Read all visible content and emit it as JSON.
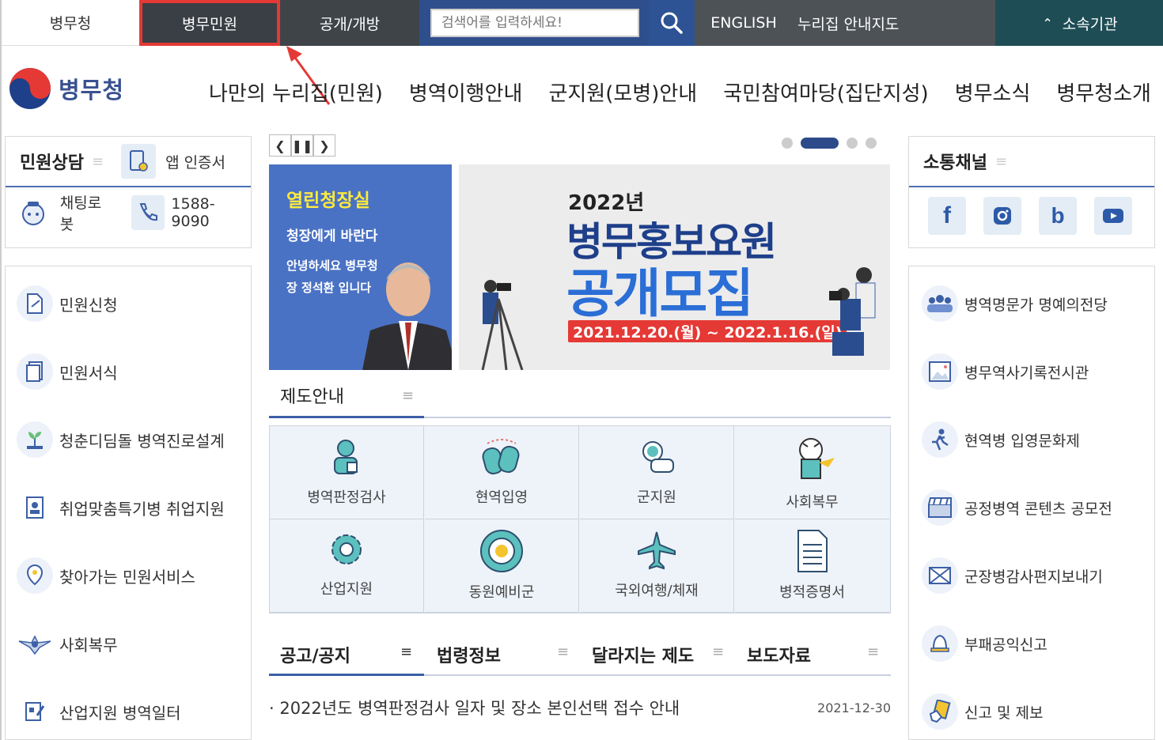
{
  "topbar": {
    "home": "병무청",
    "minwon": "병무민원",
    "open": "공개/개방",
    "search_placeholder": "검색어를 입력하세요!",
    "english": "ENGLISH",
    "sitemap": "누리집 안내지도",
    "org": "소속기관"
  },
  "header": {
    "logo": "병무청",
    "gnb": [
      "나만의 누리집(민원)",
      "병역이행안내",
      "군지원(모병)안내",
      "국민참여마당(집단지성)",
      "병무소식",
      "병무청소개"
    ]
  },
  "left": {
    "title": "민원상담",
    "app_cert": "앱 인증서",
    "chatbot": "채팅로봇",
    "phone": "1588-9090",
    "items": [
      "민원신청",
      "민원서식",
      "청춘디딤돌 병역진로설계",
      "취업맞춤특기병 취업지원",
      "찾아가는 민원서비스",
      "사회복무",
      "산업지원 병역일터"
    ]
  },
  "banner": {
    "left_title": "열린청장실",
    "left_sub": "청장에게 바란다",
    "left_msg": "안녕하세요 병무청장 정석환 입니다",
    "year": "2022년",
    "main1": "병무홍보요원",
    "main2": "공개모집",
    "dates": "2021.12.20.(월) ~ 2022.1.16.(일)"
  },
  "jedo": {
    "title": "제도안내",
    "cells": [
      "병역판정검사",
      "현역입영",
      "군지원",
      "사회복무",
      "산업지원",
      "동원예비군",
      "국외여행/체재",
      "병적증명서"
    ]
  },
  "tabs": [
    "공고/공지",
    "법령정보",
    "달라지는 제도",
    "보도자료"
  ],
  "notice": {
    "title": "· 2022년도 병역판정검사 일자 및 장소 본인선택 접수 안내",
    "date": "2021-12-30"
  },
  "right": {
    "title": "소통채널",
    "items": [
      "병역명문가 명예의전당",
      "병무역사기록전시관",
      "현역병 입영문화제",
      "공정병역 콘텐츠 공모전",
      "군장병감사편지보내기",
      "부패공익신고",
      "신고 및 제보"
    ]
  },
  "colors": {
    "accent": "#2d4a8a",
    "highlight": "#e53935"
  }
}
